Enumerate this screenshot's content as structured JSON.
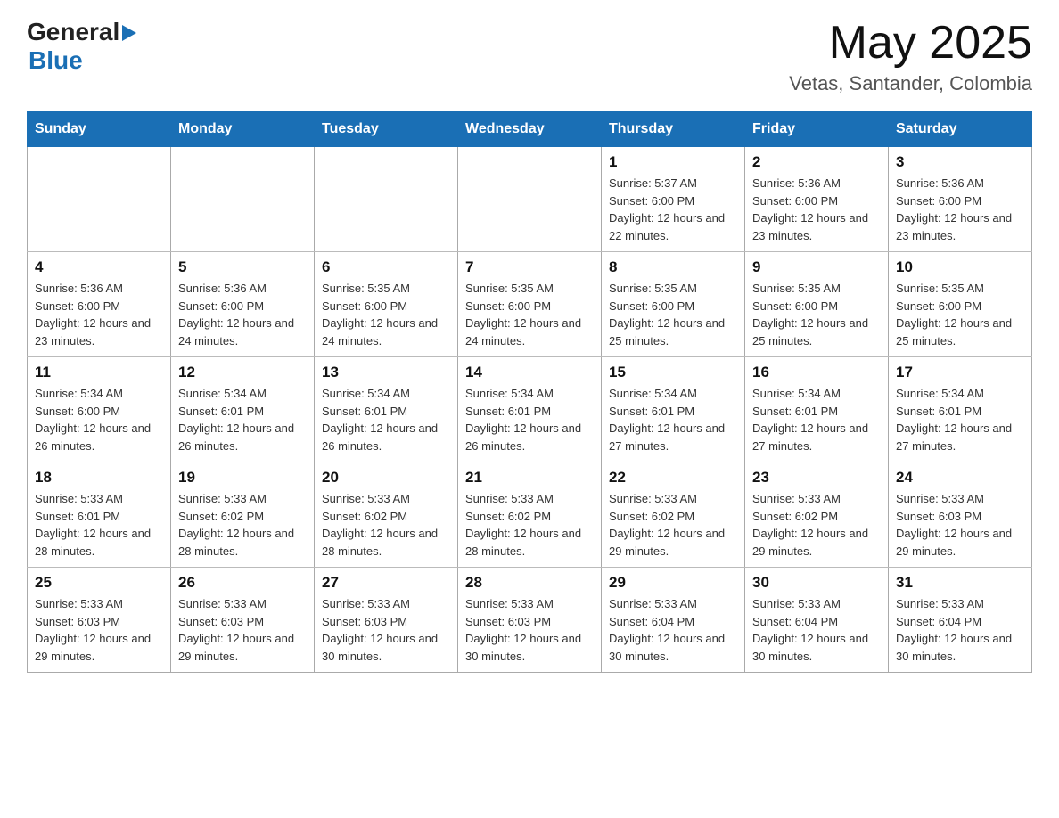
{
  "header": {
    "logo_general": "General",
    "logo_blue": "Blue",
    "month_year": "May 2025",
    "location": "Vetas, Santander, Colombia"
  },
  "days_of_week": [
    "Sunday",
    "Monday",
    "Tuesday",
    "Wednesday",
    "Thursday",
    "Friday",
    "Saturday"
  ],
  "weeks": [
    [
      {
        "day": "",
        "info": ""
      },
      {
        "day": "",
        "info": ""
      },
      {
        "day": "",
        "info": ""
      },
      {
        "day": "",
        "info": ""
      },
      {
        "day": "1",
        "info": "Sunrise: 5:37 AM\nSunset: 6:00 PM\nDaylight: 12 hours and 22 minutes."
      },
      {
        "day": "2",
        "info": "Sunrise: 5:36 AM\nSunset: 6:00 PM\nDaylight: 12 hours and 23 minutes."
      },
      {
        "day": "3",
        "info": "Sunrise: 5:36 AM\nSunset: 6:00 PM\nDaylight: 12 hours and 23 minutes."
      }
    ],
    [
      {
        "day": "4",
        "info": "Sunrise: 5:36 AM\nSunset: 6:00 PM\nDaylight: 12 hours and 23 minutes."
      },
      {
        "day": "5",
        "info": "Sunrise: 5:36 AM\nSunset: 6:00 PM\nDaylight: 12 hours and 24 minutes."
      },
      {
        "day": "6",
        "info": "Sunrise: 5:35 AM\nSunset: 6:00 PM\nDaylight: 12 hours and 24 minutes."
      },
      {
        "day": "7",
        "info": "Sunrise: 5:35 AM\nSunset: 6:00 PM\nDaylight: 12 hours and 24 minutes."
      },
      {
        "day": "8",
        "info": "Sunrise: 5:35 AM\nSunset: 6:00 PM\nDaylight: 12 hours and 25 minutes."
      },
      {
        "day": "9",
        "info": "Sunrise: 5:35 AM\nSunset: 6:00 PM\nDaylight: 12 hours and 25 minutes."
      },
      {
        "day": "10",
        "info": "Sunrise: 5:35 AM\nSunset: 6:00 PM\nDaylight: 12 hours and 25 minutes."
      }
    ],
    [
      {
        "day": "11",
        "info": "Sunrise: 5:34 AM\nSunset: 6:00 PM\nDaylight: 12 hours and 26 minutes."
      },
      {
        "day": "12",
        "info": "Sunrise: 5:34 AM\nSunset: 6:01 PM\nDaylight: 12 hours and 26 minutes."
      },
      {
        "day": "13",
        "info": "Sunrise: 5:34 AM\nSunset: 6:01 PM\nDaylight: 12 hours and 26 minutes."
      },
      {
        "day": "14",
        "info": "Sunrise: 5:34 AM\nSunset: 6:01 PM\nDaylight: 12 hours and 26 minutes."
      },
      {
        "day": "15",
        "info": "Sunrise: 5:34 AM\nSunset: 6:01 PM\nDaylight: 12 hours and 27 minutes."
      },
      {
        "day": "16",
        "info": "Sunrise: 5:34 AM\nSunset: 6:01 PM\nDaylight: 12 hours and 27 minutes."
      },
      {
        "day": "17",
        "info": "Sunrise: 5:34 AM\nSunset: 6:01 PM\nDaylight: 12 hours and 27 minutes."
      }
    ],
    [
      {
        "day": "18",
        "info": "Sunrise: 5:33 AM\nSunset: 6:01 PM\nDaylight: 12 hours and 28 minutes."
      },
      {
        "day": "19",
        "info": "Sunrise: 5:33 AM\nSunset: 6:02 PM\nDaylight: 12 hours and 28 minutes."
      },
      {
        "day": "20",
        "info": "Sunrise: 5:33 AM\nSunset: 6:02 PM\nDaylight: 12 hours and 28 minutes."
      },
      {
        "day": "21",
        "info": "Sunrise: 5:33 AM\nSunset: 6:02 PM\nDaylight: 12 hours and 28 minutes."
      },
      {
        "day": "22",
        "info": "Sunrise: 5:33 AM\nSunset: 6:02 PM\nDaylight: 12 hours and 29 minutes."
      },
      {
        "day": "23",
        "info": "Sunrise: 5:33 AM\nSunset: 6:02 PM\nDaylight: 12 hours and 29 minutes."
      },
      {
        "day": "24",
        "info": "Sunrise: 5:33 AM\nSunset: 6:03 PM\nDaylight: 12 hours and 29 minutes."
      }
    ],
    [
      {
        "day": "25",
        "info": "Sunrise: 5:33 AM\nSunset: 6:03 PM\nDaylight: 12 hours and 29 minutes."
      },
      {
        "day": "26",
        "info": "Sunrise: 5:33 AM\nSunset: 6:03 PM\nDaylight: 12 hours and 29 minutes."
      },
      {
        "day": "27",
        "info": "Sunrise: 5:33 AM\nSunset: 6:03 PM\nDaylight: 12 hours and 30 minutes."
      },
      {
        "day": "28",
        "info": "Sunrise: 5:33 AM\nSunset: 6:03 PM\nDaylight: 12 hours and 30 minutes."
      },
      {
        "day": "29",
        "info": "Sunrise: 5:33 AM\nSunset: 6:04 PM\nDaylight: 12 hours and 30 minutes."
      },
      {
        "day": "30",
        "info": "Sunrise: 5:33 AM\nSunset: 6:04 PM\nDaylight: 12 hours and 30 minutes."
      },
      {
        "day": "31",
        "info": "Sunrise: 5:33 AM\nSunset: 6:04 PM\nDaylight: 12 hours and 30 minutes."
      }
    ]
  ]
}
